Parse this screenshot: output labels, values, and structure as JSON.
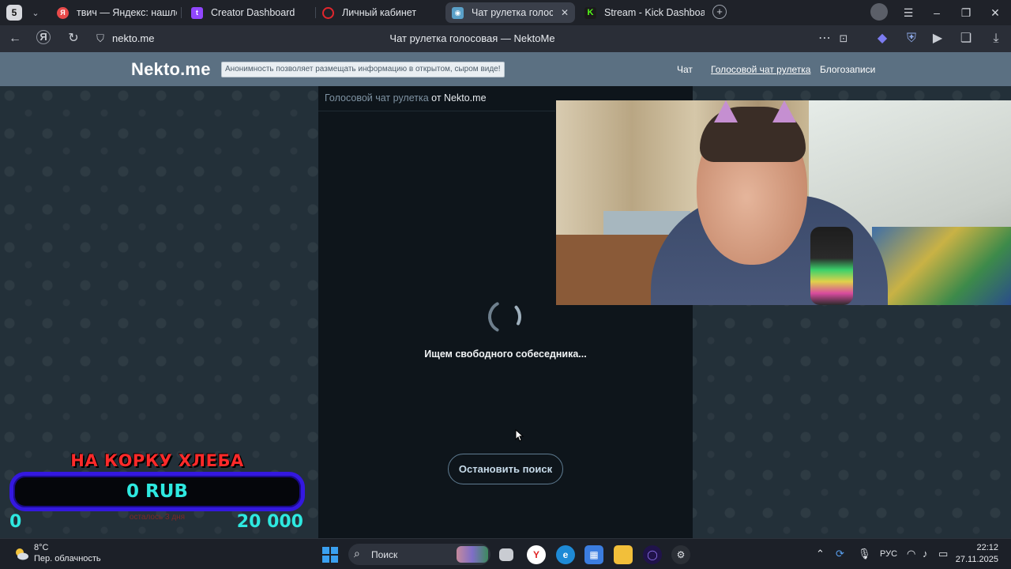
{
  "browser": {
    "tab_count": "5",
    "tabs": [
      {
        "title": "твич — Яндекс: нашлось",
        "favicon": "yandex-icon",
        "color": "#e84a4a"
      },
      {
        "title": "Creator Dashboard",
        "favicon": "twitch-icon",
        "color": "#9146ff"
      },
      {
        "title": "Личный кабинет",
        "favicon": "opera-icon",
        "color": "#e1262d"
      },
      {
        "title": "Чат рулетка голосовая",
        "favicon": "nekto-icon",
        "color": "#5aa0c8",
        "active": true
      },
      {
        "title": "Stream - Kick Dashboard",
        "favicon": "kick-icon",
        "color": "#53fc18"
      }
    ],
    "url_host": "nekto.me",
    "page_title": "Чат рулетка голосовая — NektoMe"
  },
  "site": {
    "logo": "Nekto.me",
    "tagline": "Анонимность позволяет размещать информацию в открытом, сыром виде!",
    "nav": [
      "Чат",
      "Голосовой чат рулетка",
      "Блогозаписи"
    ]
  },
  "main": {
    "breadcrumb_link": "Голосовой чат рулетка",
    "breadcrumb_rest": "от Nekto.me",
    "status": "Ищем свободного собеседника...",
    "stop_button": "Остановить поиск"
  },
  "donation_goal": {
    "title": "НА КОРКУ ХЛЕБА",
    "amount": "0 RUB",
    "min": "0",
    "max": "20 000",
    "subtitle": "осталось 3 дня",
    "progress": 0
  },
  "taskbar": {
    "weather_temp": "8°C",
    "weather_desc": "Пер. облачность",
    "search_label": "Поиск",
    "language": "РУС",
    "time": "22:12",
    "date": "27.11.2025"
  },
  "colors": {
    "site_header": "#5b7082",
    "panel_bg": "#0e151b",
    "goal_title": "#ff2a2a",
    "goal_value": "#2ee8e0",
    "goal_border": "#3418e0"
  }
}
